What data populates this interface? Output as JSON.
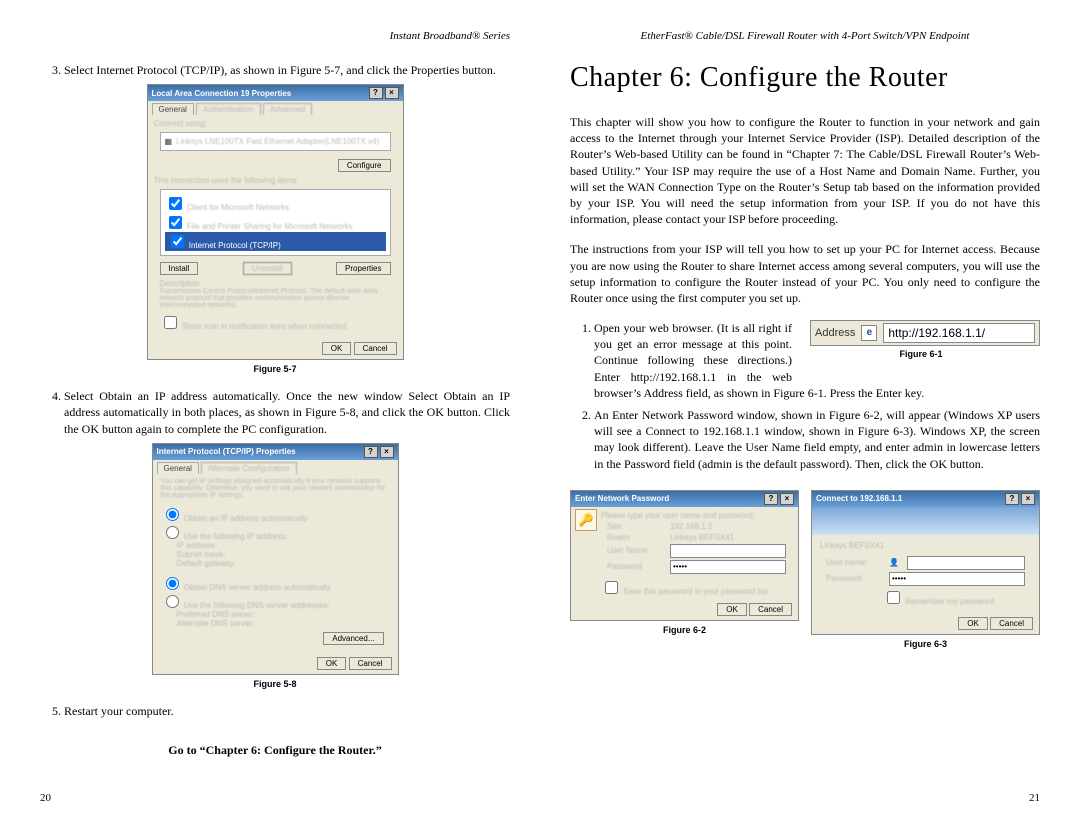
{
  "left": {
    "header": "Instant Broadband® Series",
    "step3": "Select Internet Protocol (TCP/IP), as shown in Figure 5-7, and click the Properties button.",
    "fig57_caption": "Figure 5-7",
    "step4": "Select Obtain an IP address automatically. Once the new window Select Obtain an IP address automatically in both places, as shown in Figure 5-8, and click the OK button. Click the OK button again to complete the PC configuration.",
    "fig58_caption": "Figure 5-8",
    "step5": "Restart your computer.",
    "goto": "Go to “Chapter 6: Configure the Router.”",
    "pagenum": "20",
    "fig57": {
      "title": "Local Area Connection 19 Properties",
      "tab1": "General",
      "tab2": "Authentication",
      "tab3": "Advanced",
      "connect_using": "Connect using:",
      "adapter": "Linksys LNE100TX Fast Ethernet Adapter(LNE100TX v4)",
      "configure": "Configure",
      "uses_label": "This connection uses the following items:",
      "item1": "Client for Microsoft Networks",
      "item2": "File and Printer Sharing for Microsoft Networks",
      "item3": "Internet Protocol (TCP/IP)",
      "install": "Install",
      "uninstall": "Uninstall",
      "properties": "Properties",
      "desc_label": "Description",
      "desc": "Transmission Control Protocol/Internet Protocol. The default wide area network protocol that provides communication across diverse interconnected networks.",
      "showicon": "Show icon in notification area when connected",
      "ok": "OK",
      "cancel": "Cancel"
    },
    "fig58": {
      "title": "Internet Protocol (TCP/IP) Properties",
      "tab1": "General",
      "tab2": "Alternate Configuration",
      "intro": "You can get IP settings assigned automatically if your network supports this capability. Otherwise, you need to ask your network administrator for the appropriate IP settings.",
      "radio1": "Obtain an IP address automatically",
      "radio2": "Use the following IP address:",
      "ip": "IP address:",
      "subnet": "Subnet mask:",
      "gateway": "Default gateway:",
      "radio3": "Obtain DNS server address automatically",
      "radio4": "Use the following DNS server addresses:",
      "dns1": "Preferred DNS server:",
      "dns2": "Alternate DNS server:",
      "advanced": "Advanced...",
      "ok": "OK",
      "cancel": "Cancel"
    }
  },
  "right": {
    "header": "EtherFast® Cable/DSL Firewall Router with 4-Port Switch/VPN Endpoint",
    "chapter": "Chapter 6: Configure the Router",
    "para1": "This chapter will show you how to configure the Router to function in your network and gain access to the Internet through your Internet Service Provider (ISP). Detailed description of the Router’s Web-based Utility can be found in “Chapter 7: The Cable/DSL Firewall Router’s Web-based Utility.” Your ISP may require the use of a Host Name and Domain Name. Further, you will set the WAN Connection Type on the Router’s Setup tab based on the information provided by your ISP. You will need the setup information from your ISP. If you do not have this information, please contact your ISP before proceeding.",
    "para2": "The instructions from your ISP will tell you how to set up your PC for Internet access.  Because you are now using the Router to share Internet access among several computers, you will use the setup information to configure the Router instead of your PC. You only need to configure the Router once using the first computer you set up.",
    "step1a": "Open your web browser. (It is all right if you get an error message at this point. Continue following these",
    "step1b": "directions.) Enter http://192.168.1.1 in the web browser’s Address field, as shown in Figure 6-1. Press the Enter key.",
    "fig61_caption": "Figure 6-1",
    "step2": "An Enter Network Password window, shown in Figure 6-2, will appear (Windows XP users will see a Connect to 192.168.1.1 window, shown in Figure 6-3). Windows XP, the screen may look different). Leave the User Name field empty, and enter admin in lowercase letters in the Password field (admin is the default password).  Then, click the OK button.",
    "fig62_caption": "Figure 6-2",
    "fig63_caption": "Figure 6-3",
    "pagenum": "21",
    "addr": {
      "label": "Address",
      "url": "http://192.168.1.1/"
    },
    "fig62": {
      "title": "Enter Network Password",
      "prompt": "Please type your user name and password.",
      "site_l": "Site:",
      "site_v": "192.168.1.1",
      "realm_l": "Realm",
      "realm_v": "Linksys BEFSX41",
      "user_l": "User Name",
      "pass_l": "Password",
      "pass_v": "•••••",
      "save": "Save this password in your password list",
      "ok": "OK",
      "cancel": "Cancel"
    },
    "fig63": {
      "title": "Connect to 192.168.1.1",
      "realm": "Linksys BEFSX41",
      "user_l": "User name:",
      "pass_l": "Password:",
      "pass_v": "•••••",
      "remember": "Remember my password",
      "ok": "OK",
      "cancel": "Cancel"
    }
  }
}
